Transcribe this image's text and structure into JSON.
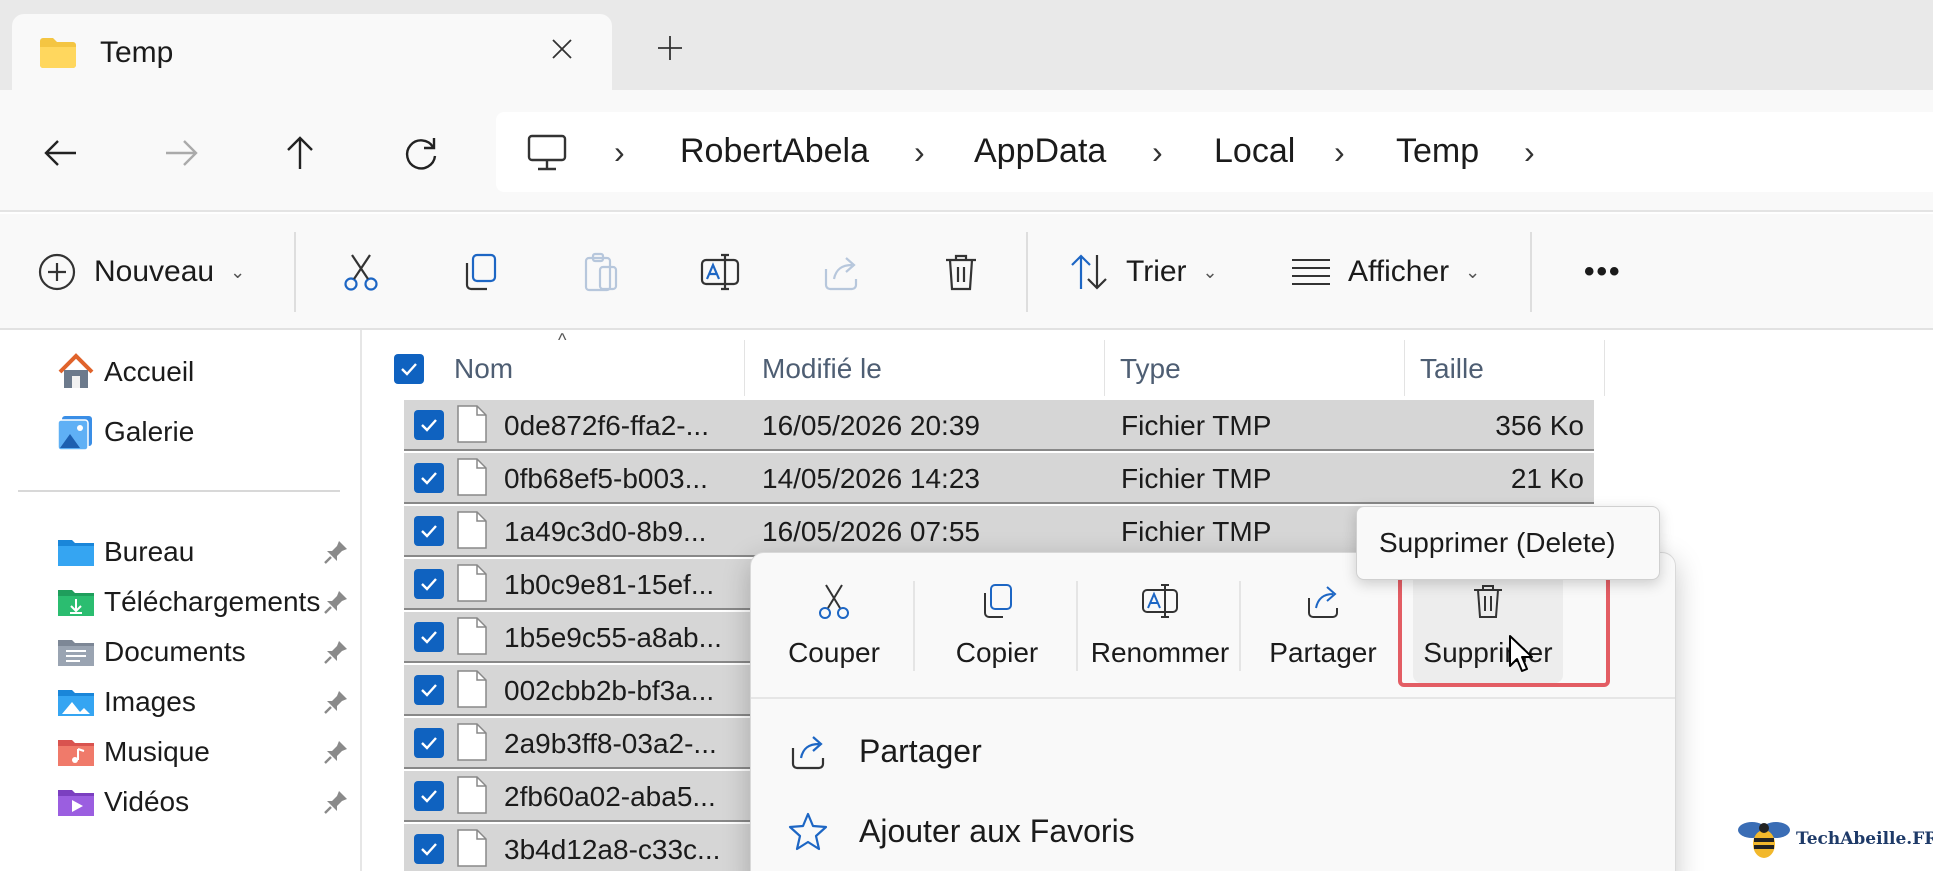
{
  "tab": {
    "title": "Temp"
  },
  "breadcrumb": [
    "RobertAbela",
    "AppData",
    "Local",
    "Temp"
  ],
  "toolbar": {
    "new_label": "Nouveau",
    "sort_label": "Trier",
    "view_label": "Afficher",
    "more_label": "•••"
  },
  "sidebar": {
    "top_items": [
      {
        "label": "Accueil",
        "icon": "home-icon"
      },
      {
        "label": "Galerie",
        "icon": "gallery-icon"
      }
    ],
    "pinned_items": [
      {
        "label": "Bureau",
        "icon": "desktop-folder-icon"
      },
      {
        "label": "Téléchargements",
        "icon": "downloads-folder-icon"
      },
      {
        "label": "Documents",
        "icon": "documents-folder-icon"
      },
      {
        "label": "Images",
        "icon": "pictures-folder-icon"
      },
      {
        "label": "Musique",
        "icon": "music-folder-icon"
      },
      {
        "label": "Vidéos",
        "icon": "videos-folder-icon"
      }
    ]
  },
  "columns": {
    "name": "Nom",
    "modified": "Modifié le",
    "type": "Type",
    "size": "Taille"
  },
  "files": [
    {
      "name": "0de872f6-ffa2-...",
      "modified": "16/05/2026 20:39",
      "type": "Fichier TMP",
      "size": "356 Ko"
    },
    {
      "name": "0fb68ef5-b003...",
      "modified": "14/05/2026 14:23",
      "type": "Fichier TMP",
      "size": "21 Ko"
    },
    {
      "name": "1a49c3d0-8b9...",
      "modified": "16/05/2026 07:55",
      "type": "Fichier TMP",
      "size": ""
    },
    {
      "name": "1b0c9e81-15ef...",
      "modified": "",
      "type": "",
      "size": ""
    },
    {
      "name": "1b5e9c55-a8ab...",
      "modified": "",
      "type": "",
      "size": ""
    },
    {
      "name": "002cbb2b-bf3a...",
      "modified": "",
      "type": "",
      "size": ""
    },
    {
      "name": "2a9b3ff8-03a2-...",
      "modified": "",
      "type": "",
      "size": ""
    },
    {
      "name": "2fb60a02-aba5...",
      "modified": "",
      "type": "",
      "size": ""
    },
    {
      "name": "3b4d12a8-c33c...",
      "modified": "",
      "type": "",
      "size": ""
    }
  ],
  "context_menu": {
    "quick_actions": [
      "Couper",
      "Copier",
      "Renommer",
      "Partager",
      "Supprimer"
    ],
    "items": [
      "Partager",
      "Ajouter aux Favoris"
    ]
  },
  "tooltip": "Supprimer (Delete)",
  "watermark": "TechAbeille.FR",
  "colors": {
    "accent": "#0f62c0",
    "selection": "#d6d6d6",
    "highlight": "#e35d64"
  }
}
